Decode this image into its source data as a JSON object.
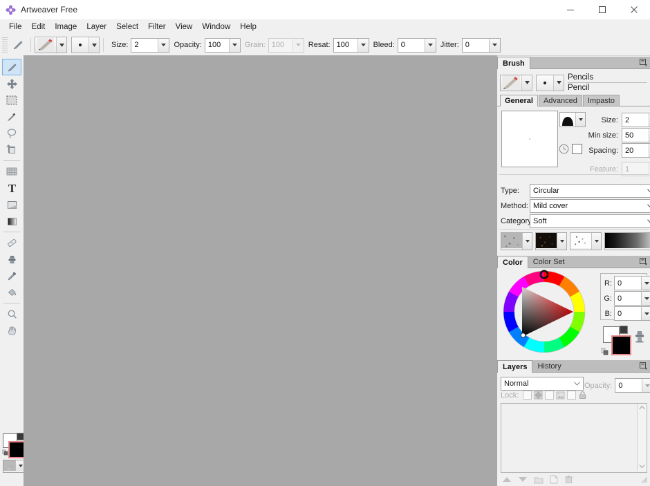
{
  "window": {
    "title": "Artweaver Free",
    "app_icon": "flower-icon",
    "controls": [
      {
        "name": "minimize",
        "glyph": "minimize-icon"
      },
      {
        "name": "maximize",
        "glyph": "maximize-icon"
      },
      {
        "name": "close",
        "glyph": "close-icon"
      }
    ]
  },
  "menubar": {
    "items": [
      "File",
      "Edit",
      "Image",
      "Layer",
      "Select",
      "Filter",
      "View",
      "Window",
      "Help"
    ]
  },
  "options_toolbar": {
    "current_tool_icon": "brush-icon",
    "brush_preset_icon": "pencil-preset-icon",
    "tip_preset_icon": "dot-tip-icon",
    "fields": [
      {
        "label": "Size:",
        "value": "2",
        "enabled": true
      },
      {
        "label": "Opacity:",
        "value": "100",
        "enabled": true
      },
      {
        "label": "Grain:",
        "value": "100",
        "enabled": false
      },
      {
        "label": "Resat:",
        "value": "100",
        "enabled": true
      },
      {
        "label": "Bleed:",
        "value": "0",
        "enabled": true
      },
      {
        "label": "Jitter:",
        "value": "0",
        "enabled": true
      }
    ]
  },
  "toolbox": {
    "tools": [
      {
        "name": "brush-tool",
        "icon": "brush-icon",
        "active": true
      },
      {
        "name": "move-tool",
        "icon": "move-icon",
        "active": false
      },
      {
        "name": "rect-select-tool",
        "icon": "marquee-icon",
        "active": false
      },
      {
        "name": "magic-wand-tool",
        "icon": "wand-icon",
        "active": false
      },
      {
        "name": "lasso-tool",
        "icon": "lasso-icon",
        "active": false
      },
      {
        "name": "crop-tool",
        "icon": "crop-icon",
        "active": false
      },
      {
        "name": "divider-1",
        "icon": "divider",
        "active": false
      },
      {
        "name": "pattern-tool",
        "icon": "pattern-icon",
        "active": false
      },
      {
        "name": "text-tool",
        "icon": "text-icon",
        "active": false
      },
      {
        "name": "shape-tool",
        "icon": "shape-icon",
        "active": false
      },
      {
        "name": "gradient-tool",
        "icon": "gradient-icon",
        "active": false
      },
      {
        "name": "divider-2",
        "icon": "divider",
        "active": false
      },
      {
        "name": "eraser-tool",
        "icon": "eraser-icon",
        "active": false
      },
      {
        "name": "clone-stamp-tool",
        "icon": "stamp-icon",
        "active": false
      },
      {
        "name": "eyedropper-tool",
        "icon": "eyedropper-icon",
        "active": false
      },
      {
        "name": "paint-bucket-tool",
        "icon": "bucket-icon",
        "active": false
      },
      {
        "name": "divider-3",
        "icon": "divider",
        "active": false
      },
      {
        "name": "zoom-tool",
        "icon": "magnifier-icon",
        "active": false
      },
      {
        "name": "hand-tool",
        "icon": "hand-icon",
        "active": false
      }
    ],
    "foreground_color": "#000000",
    "background_color": "#ffffff",
    "paper_texture": "paper-swatch"
  },
  "canvas": {
    "background_color": "#a8a8a8"
  },
  "brush_panel": {
    "tabs": [
      {
        "label": "Brush",
        "active": true
      }
    ],
    "panel_menu_icon": "panel-menu-icon",
    "category": "Pencils",
    "variant": "Pencil",
    "sub_tabs": [
      {
        "label": "General",
        "active": true
      },
      {
        "label": "Advanced",
        "active": false
      },
      {
        "label": "Impasto",
        "active": false
      }
    ],
    "preview_label": "brush-preview",
    "tip_shape_icon": "brush-tip-icon",
    "timing_icon": "clock-icon",
    "spacing_checkbox": false,
    "fields": [
      {
        "label": "Size:",
        "value": "2",
        "enabled": true
      },
      {
        "label": "Min size:",
        "value": "50",
        "enabled": true
      },
      {
        "label": "Spacing:",
        "value": "20",
        "enabled": true
      },
      {
        "label": "Feature:",
        "value": "1",
        "enabled": false
      }
    ],
    "selects": [
      {
        "label": "Type:",
        "value": "Circular"
      },
      {
        "label": "Method:",
        "value": "Mild cover"
      },
      {
        "label": "Category:",
        "value": "Soft"
      }
    ],
    "swatches": [
      {
        "name": "grain-swatch",
        "kind": "noise-gray"
      },
      {
        "name": "texture-swatch",
        "kind": "dark-dots"
      },
      {
        "name": "splatter-swatch",
        "kind": "speckle-white"
      },
      {
        "name": "gradient-swatch",
        "kind": "black-to-white"
      }
    ]
  },
  "color_panel": {
    "tabs": [
      {
        "label": "Color",
        "active": true
      },
      {
        "label": "Color Set",
        "active": false
      }
    ],
    "panel_menu_icon": "panel-menu-icon",
    "wheel_icon": "color-wheel",
    "channels": [
      {
        "label": "R:",
        "value": "0"
      },
      {
        "label": "G:",
        "value": "0"
      },
      {
        "label": "B:",
        "value": "0"
      }
    ],
    "foreground_color": "#000000",
    "background_color": "#ffffff",
    "clone_icon": "clone-color-icon",
    "reset_icon": "reset-colors-icon"
  },
  "layers_panel": {
    "tabs": [
      {
        "label": "Layers",
        "active": true
      },
      {
        "label": "History",
        "active": false
      }
    ],
    "panel_menu_icon": "panel-menu-icon",
    "blend_mode": "Normal",
    "opacity_label": "Opacity:",
    "opacity_value": "0",
    "lock_label": "Lock:",
    "lock_toggles": [
      {
        "name": "lock-transparency",
        "icon": "transparency-icon",
        "checked": false
      },
      {
        "name": "lock-image",
        "icon": "image-icon",
        "checked": false
      },
      {
        "name": "lock-all",
        "icon": "lock-icon",
        "checked": false
      }
    ],
    "layers": [],
    "buttons": [
      {
        "name": "move-layer-up",
        "icon": "arrow-up-icon"
      },
      {
        "name": "move-layer-down",
        "icon": "arrow-down-icon"
      },
      {
        "name": "new-group",
        "icon": "folder-icon"
      },
      {
        "name": "new-layer",
        "icon": "new-page-icon"
      },
      {
        "name": "delete-layer",
        "icon": "trash-icon"
      }
    ]
  }
}
